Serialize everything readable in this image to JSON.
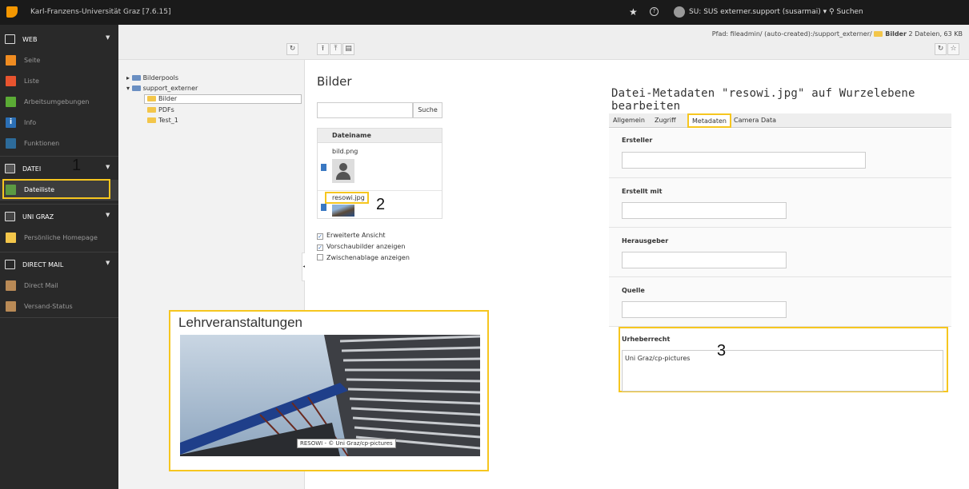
{
  "topbar": {
    "site_name": "Karl-Franzens-Universität Graz [7.6.15]",
    "user": "SU: SUS externer.support (susarmai) ▾",
    "search": "Suchen",
    "star_icon": "star-icon",
    "help_icon": "help-icon"
  },
  "menu": {
    "groups": [
      {
        "label": "WEB"
      },
      {
        "label": "DATEI"
      },
      {
        "label": "UNI GRAZ"
      },
      {
        "label": "DIRECT MAIL"
      }
    ],
    "web_items": [
      "Seite",
      "Liste",
      "Arbeitsumgebungen",
      "Info",
      "Funktionen"
    ],
    "datei_items": [
      "Dateiliste"
    ],
    "unigraz_items": [
      "Persönliche Homepage"
    ],
    "directmail_items": [
      "Direct Mail",
      "Versand-Status"
    ],
    "colors": {
      "seite": "#f08c21",
      "liste": "#e8542f",
      "arbeit": "#5bab35",
      "info": "#2b6fb5",
      "funktionen": "#2d6b9a",
      "dateiliste": "#5b9a43"
    }
  },
  "tree": {
    "root": "Bilderpools",
    "storage": "support_externer",
    "folders": [
      "Bilder",
      "PDFs",
      "Test_1"
    ]
  },
  "content": {
    "path_label": "Pfad: fileadmin/ (auto-created):/support_externer/",
    "path_folder": "Bilder",
    "path_info": "2 Dateien, 63 KB",
    "list_title": "Bilder",
    "search_button": "Suche",
    "col_filename": "Dateiname",
    "files": [
      "bild.png",
      "resowi.jpg"
    ],
    "options": [
      {
        "label": "Erweiterte Ansicht",
        "checked": true
      },
      {
        "label": "Vorschaubilder anzeigen",
        "checked": true
      },
      {
        "label": "Zwischenablage anzeigen",
        "checked": false
      }
    ]
  },
  "metadata": {
    "title": "Datei-Metadaten \"resowi.jpg\" auf Wurzelebene bearbeiten",
    "tabs": [
      "Allgemein",
      "Zugriff",
      "Metadaten",
      "Camera Data"
    ],
    "active_tab": "Metadaten",
    "fields": {
      "creator": "Ersteller",
      "creator_tool": "Erstellt mit",
      "publisher": "Herausgeber",
      "source": "Quelle",
      "copyright": "Urheberrecht",
      "copyright_value": "Uni Graz/cp-pictures"
    }
  },
  "annotations": {
    "n1": "1",
    "n2": "2",
    "n3": "3"
  },
  "overlay": {
    "title": "Lehrveranstaltungen",
    "caption": "RESOWI - © Uni Graz/cp-pictures"
  }
}
